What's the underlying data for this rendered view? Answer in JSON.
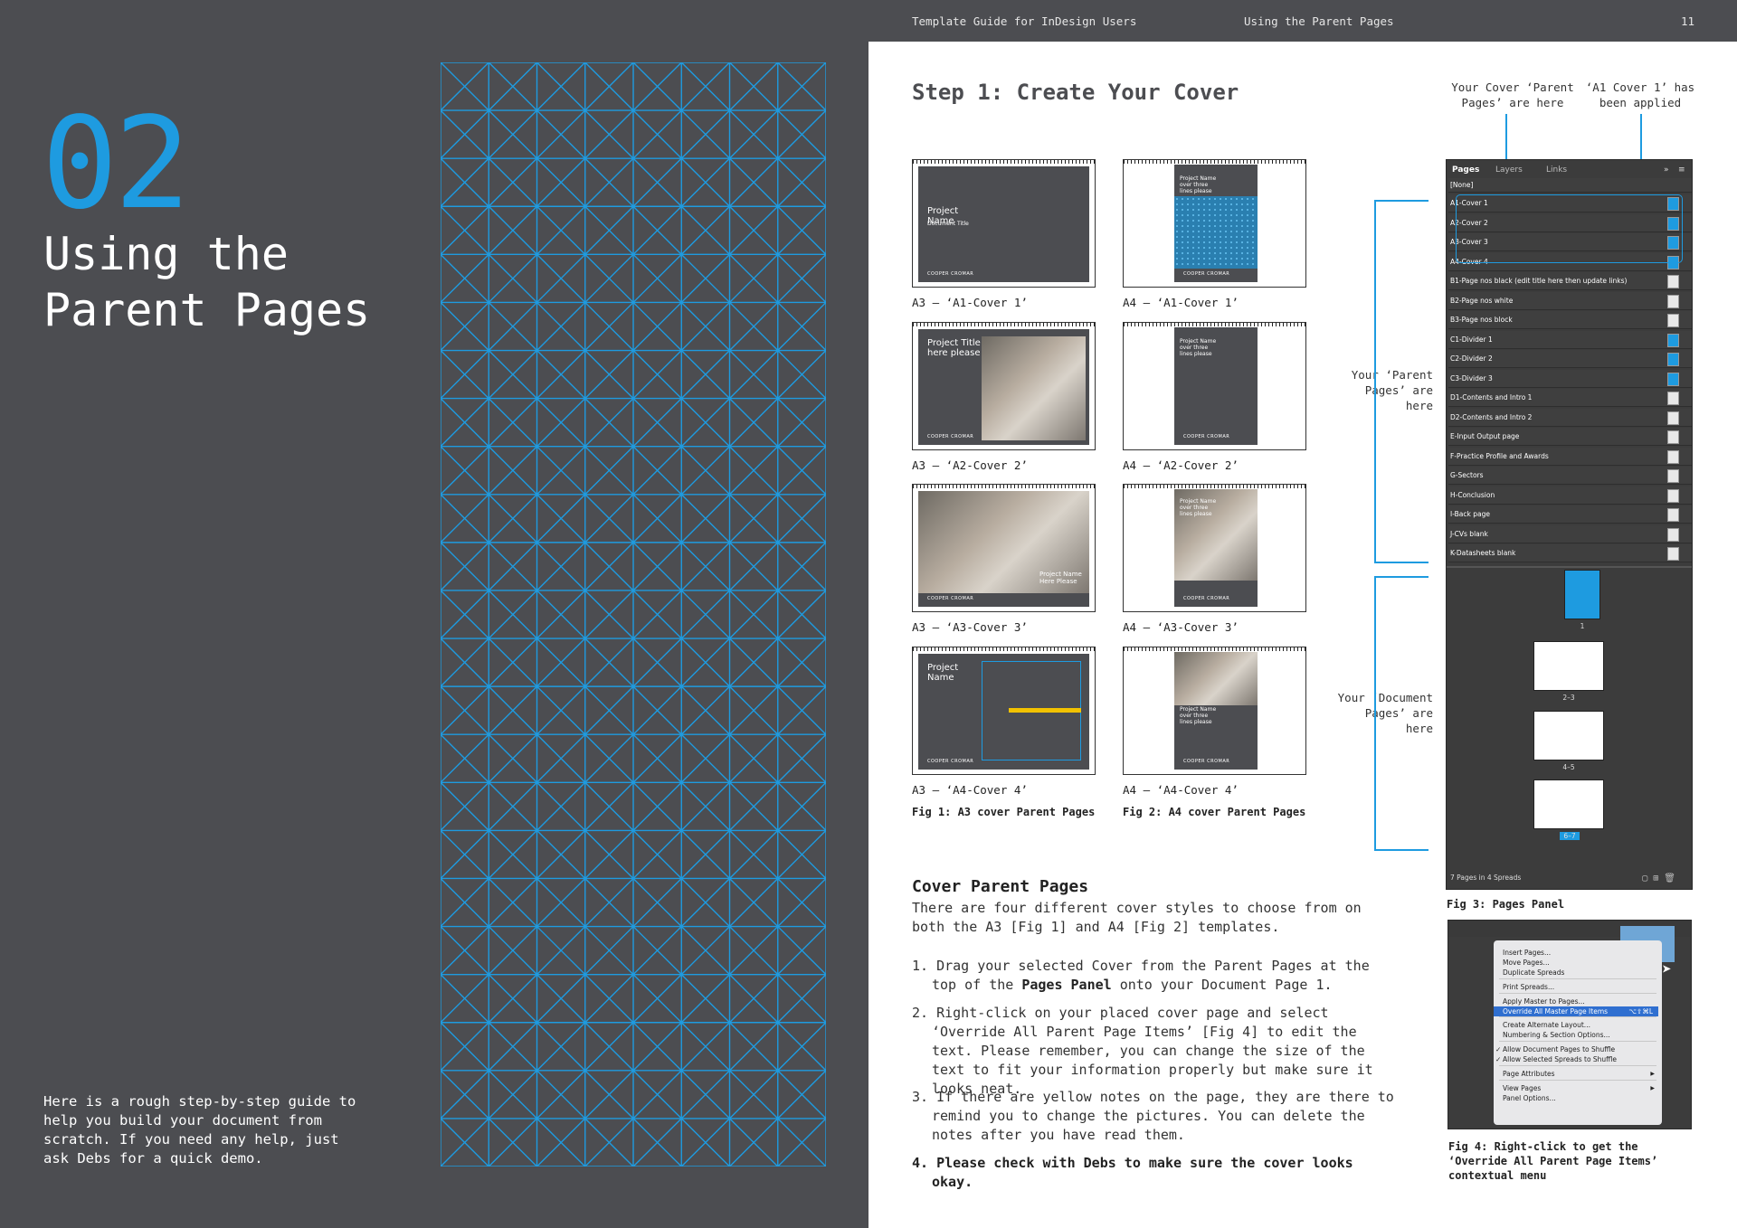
{
  "left_page": {
    "chapter_number": "02",
    "chapter_title": "Using the Parent Pages",
    "intro": "Here is a rough step-by-step guide to help you build your document from scratch. If you need any help, just ask Debs for a quick demo."
  },
  "header": {
    "guide": "Template Guide for InDesign Users",
    "section": "Using the Parent Pages",
    "page_number": "11"
  },
  "step_title": "Step 1: Create Your Cover",
  "covers": [
    {
      "caption": "A3 – ‘A1-Cover 1’",
      "name": "Project Name",
      "sub": "Document Title"
    },
    {
      "caption": "A4 – ‘A1-Cover 1’",
      "name": "Project Name over three lines please"
    },
    {
      "caption": "A3 – ‘A2-Cover 2’",
      "name": "Project Title here please"
    },
    {
      "caption": "A4 – ‘A2-Cover 2’",
      "name": "Project Name over three lines please"
    },
    {
      "caption": "A3 – ‘A3-Cover 3’",
      "name": "Project Name Here Please"
    },
    {
      "caption": "A4 – ‘A3-Cover 3’",
      "name": "Project Name over three lines please"
    },
    {
      "caption": "A3 – ‘A4-Cover 4’",
      "name": "Project Name"
    },
    {
      "caption": "A4 – ‘A4-Cover 4’",
      "name": "Project Name over three lines please"
    }
  ],
  "brand": "COOPER CROMAR",
  "fig1": "Fig 1: A3 cover Parent Pages",
  "fig2": "Fig 2: A4 cover Parent Pages",
  "notes": {
    "cover_parent": "Your Cover ‘Parent Pages’ are here",
    "applied": "‘A1 Cover 1’ has been applied",
    "parent_pages": "Your ‘Parent Pages’ are here",
    "document_pages": "Your ‘Document Pages’ are here"
  },
  "cover_parent_pages": {
    "heading": "Cover Parent Pages",
    "body": "There are four different cover styles to choose from on both the A3 [Fig 1] and A4 [Fig 2] templates.",
    "steps": [
      {
        "pre": "1. Drag your selected Cover from the Parent Pages at the top of the ",
        "bold": "Pages Panel",
        "post": " onto your Document Page 1."
      },
      {
        "pre": "2. Right-click on your placed cover page and select ‘Override All Parent Page Items’ [Fig 4] to edit the text. Please remember, you can change the size of the text to fit your information properly but make sure it looks neat.",
        "bold": "",
        "post": ""
      },
      {
        "pre": "3. If there are yellow notes on the page, they are there to remind you to change the pictures. You can delete the notes after you have read them.",
        "bold": "",
        "post": ""
      },
      {
        "pre": "",
        "bold": "4. Please check with Debs to make sure the cover looks okay.",
        "post": ""
      }
    ]
  },
  "pages_panel": {
    "tabs": [
      "Pages",
      "Layers",
      "Links"
    ],
    "none_label": "[None]",
    "parents": [
      "A1-Cover 1",
      "A2-Cover 2",
      "A3-Cover 3",
      "A4-Cover 4",
      "B1-Page nos black (edit title here then update links)",
      "B2-Page nos white",
      "B3-Page nos block",
      "C1-Divider 1",
      "C2-Divider 2",
      "C3-Divider 3",
      "D1-Contents and Intro 1",
      "D2-Contents and Intro 2",
      "E-Input Output page",
      "F-Practice Profile and Awards",
      "G-Sectors",
      "H-Conclusion",
      "I-Back page",
      "J-CVs blank",
      "K-Datasheets blank"
    ],
    "spreads": [
      "1",
      "2–3",
      "4–5",
      "6–7"
    ],
    "footer": "7 Pages in 4 Spreads"
  },
  "fig3": "Fig 3: Pages Panel",
  "context_menu": [
    "Insert Pages...",
    "Move Pages...",
    "Duplicate Spreads",
    "Print Spreads...",
    "Apply Master to Pages...",
    "Override All Master Page Items",
    "Create Alternate Layout...",
    "Numbering & Section Options...",
    "Allow Document Pages to Shuffle",
    "Allow Selected Spreads to Shuffle",
    "Page Attributes",
    "View Pages",
    "Panel Options..."
  ],
  "shortcut": "⌥⇧⌘L",
  "fig4": "Fig 4: Right-click to get the ‘Override All Parent Page Items’ contextual menu",
  "colors": {
    "accent": "#1e9be0",
    "dark": "#4c4d51",
    "highlight": "#f2c200"
  }
}
